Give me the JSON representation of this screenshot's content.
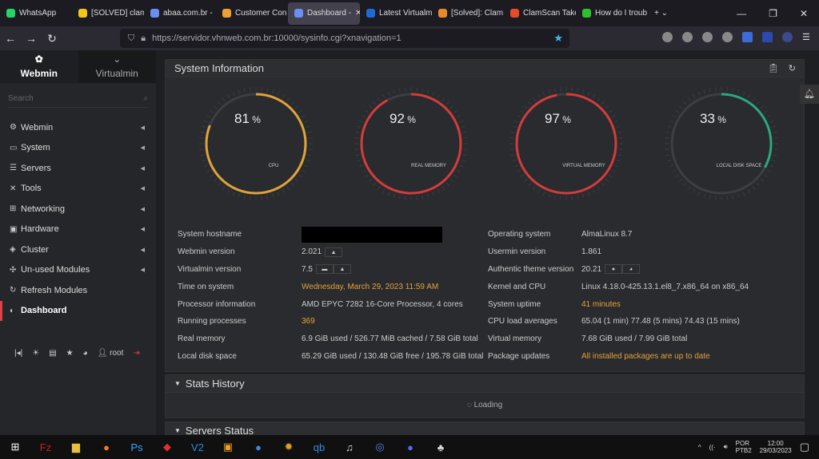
{
  "browser": {
    "tabs": [
      {
        "label": "WhatsApp",
        "color": "#25d366"
      },
      {
        "label": "[SOLVED] clam",
        "color": "#f5c518"
      },
      {
        "label": "abaa.com.br -",
        "color": "#6b8ef0"
      },
      {
        "label": "Customer Con",
        "color": "#f0a030"
      },
      {
        "label": "Dashboard -",
        "color": "#6b8ef0",
        "active": true
      },
      {
        "label": "Latest Virtualm",
        "color": "#1e6bd6"
      },
      {
        "label": "[Solved]: Clam",
        "color": "#e88a2a"
      },
      {
        "label": "ClamScan Take",
        "color": "#e84a2a"
      },
      {
        "label": "How do I troub",
        "color": "#2ec02e"
      }
    ],
    "url": "https://servidor.vhnweb.com.br:10000/sysinfo.cgi?xnavigation=1"
  },
  "sidebar": {
    "tabs": [
      {
        "label": "Webmin"
      },
      {
        "label": "Virtualmin"
      }
    ],
    "search_placeholder": "Search",
    "items": [
      {
        "label": "Webmin",
        "icon": "gear-icon",
        "glyph": "⚙"
      },
      {
        "label": "System",
        "icon": "laptop-icon",
        "glyph": "▭"
      },
      {
        "label": "Servers",
        "icon": "servers-icon",
        "glyph": "☰"
      },
      {
        "label": "Tools",
        "icon": "tools-icon",
        "glyph": "✕"
      },
      {
        "label": "Networking",
        "icon": "network-icon",
        "glyph": "⊞"
      },
      {
        "label": "Hardware",
        "icon": "hdd-icon",
        "glyph": "▣"
      },
      {
        "label": "Cluster",
        "icon": "cluster-icon",
        "glyph": "◈"
      },
      {
        "label": "Un-used Modules",
        "icon": "puzzle-icon",
        "glyph": "✣"
      },
      {
        "label": "Refresh Modules",
        "icon": "refresh-icon",
        "glyph": "↻"
      },
      {
        "label": "Dashboard",
        "icon": "dashboard-icon",
        "glyph": "◐",
        "active": true
      }
    ],
    "user": "root"
  },
  "sysinfo": {
    "title": "System Information",
    "gauges": [
      {
        "label": "CPU",
        "value": 81,
        "color": "#e0a33a"
      },
      {
        "label": "REAL MEMORY",
        "value": 92,
        "color": "#d23c3c"
      },
      {
        "label": "VIRTUAL MEMORY",
        "value": 97,
        "color": "#d23c3c"
      },
      {
        "label": "LOCAL DISK SPACE",
        "value": 33,
        "color": "#2aa87e"
      }
    ],
    "left": [
      {
        "k": "System hostname",
        "v": ""
      },
      {
        "k": "Webmin version",
        "v": "2.021"
      },
      {
        "k": "Virtualmin version",
        "v": "7.5"
      },
      {
        "k": "Time on system",
        "v": "Wednesday, March 29, 2023 11:59 AM",
        "hl": true
      },
      {
        "k": "Processor information",
        "v": "AMD EPYC 7282 16-Core Processor, 4 cores"
      },
      {
        "k": "Running processes",
        "v": "369",
        "hl": true
      },
      {
        "k": "Real memory",
        "v": "6.9 GiB used / 526.77 MiB cached / 7.58 GiB total"
      },
      {
        "k": "Local disk space",
        "v": "65.29 GiB used / 130.48 GiB free / 195.78 GiB total"
      }
    ],
    "right": [
      {
        "k": "Operating system",
        "v": "AlmaLinux 8.7"
      },
      {
        "k": "Usermin version",
        "v": "1.861"
      },
      {
        "k": "Authentic theme version",
        "v": "20.21"
      },
      {
        "k": "Kernel and CPU",
        "v": "Linux 4.18.0-425.13.1.el8_7.x86_64 on x86_64"
      },
      {
        "k": "System uptime",
        "v": "41 minutes",
        "hl": true
      },
      {
        "k": "CPU load averages",
        "v": "65.04 (1 min) 77.48 (5 mins) 74.43 (15 mins)"
      },
      {
        "k": "Virtual memory",
        "v": "7.68 GiB used / 7.99 GiB total"
      },
      {
        "k": "Package updates",
        "v": "All installed packages are up to date",
        "hl": true
      }
    ]
  },
  "stats": {
    "title": "Stats History",
    "loading": "Loading"
  },
  "servers": {
    "title": "Servers Status"
  },
  "taskbar": {
    "lang1": "POR",
    "lang2": "PTB2",
    "time": "12:00",
    "date": "29/03/2023"
  }
}
